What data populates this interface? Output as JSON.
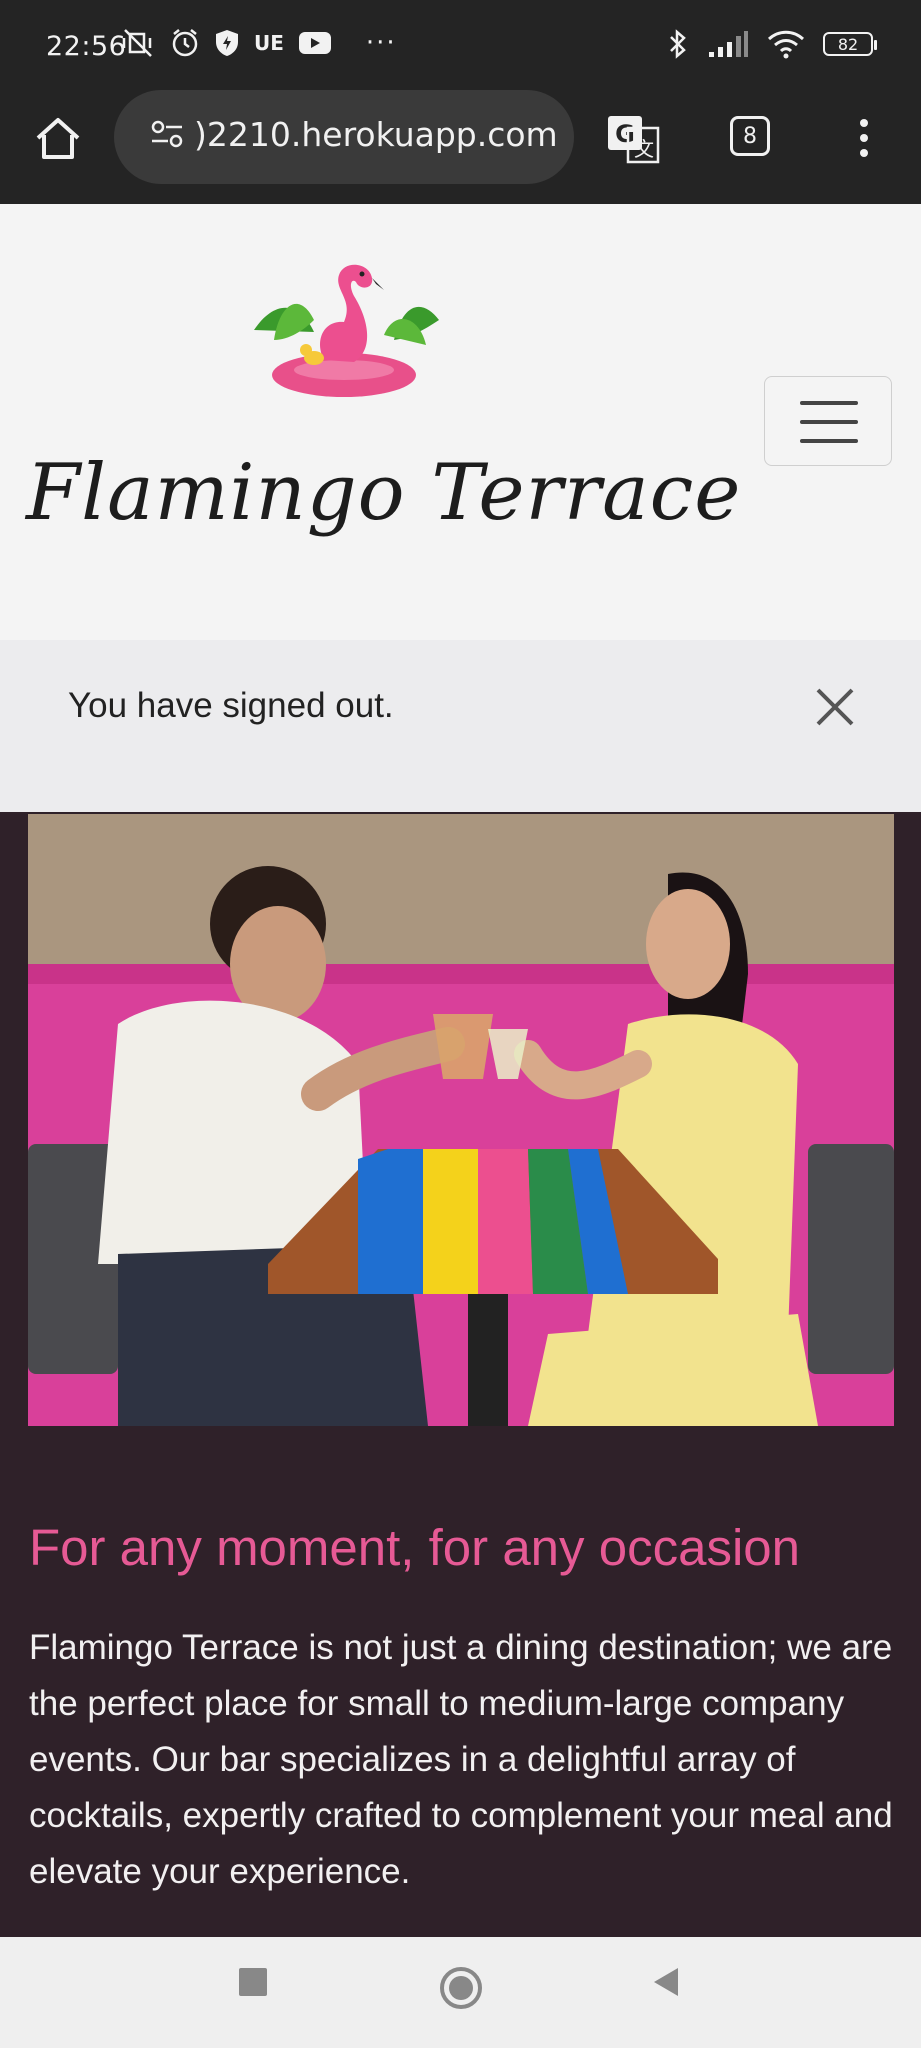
{
  "status_bar": {
    "time": "22:56",
    "carrier_tag": "UE",
    "more": "···",
    "battery": "82",
    "icons": [
      "vibrate-off-icon",
      "alarm-icon",
      "shield-icon",
      "youtube-icon",
      "bluetooth-icon",
      "signal-icon",
      "wifi-icon",
      "battery-icon"
    ]
  },
  "browser": {
    "url": ")2210.herokuapp.com",
    "tab_count": "8",
    "icons": [
      "home-icon",
      "site-settings-icon",
      "translate-icon",
      "tabs-icon",
      "more-vert-icon"
    ]
  },
  "site": {
    "brand_name": "Flamingo Terrace",
    "logo": "flamingo-logo"
  },
  "alert": {
    "message": "You have signed out."
  },
  "content": {
    "heading": "For any moment, for any occasion",
    "body": "Flamingo Terrace is not just a dining destination; we are the perfect place for small to medium-large company events. Our bar specializes in a delightful array of cocktails, expertly crafted to complement your meal and elevate your experience."
  },
  "colors": {
    "heading_accent": "#e65a95",
    "page_background": "#2f2129",
    "header_background": "#f4f4f4",
    "alert_background": "#ececee"
  },
  "nav_bar": {
    "icons": [
      "recents-square-icon",
      "home-circle-icon",
      "back-triangle-icon"
    ]
  }
}
